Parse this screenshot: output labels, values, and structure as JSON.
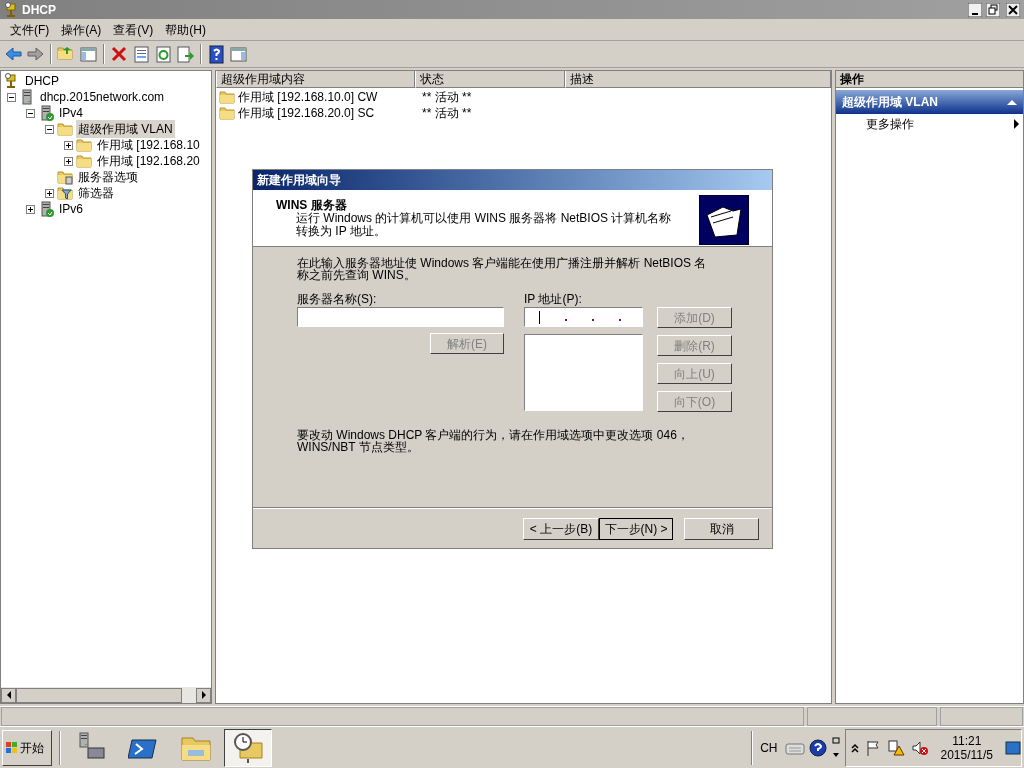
{
  "window": {
    "title": "DHCP"
  },
  "menu": [
    {
      "label": "文件(F)"
    },
    {
      "label": "操作(A)"
    },
    {
      "label": "查看(V)"
    },
    {
      "label": "帮助(H)"
    }
  ],
  "tree": [
    {
      "kind": "dhcp",
      "label": "DHCP",
      "selected": false,
      "children": [
        {
          "kind": "server",
          "label": "dhcp.2015network.com",
          "selected": false,
          "expanded": true,
          "children": [
            {
              "kind": "ipv4",
              "label": "IPv4",
              "selected": false,
              "expanded": true,
              "children": [
                {
                  "kind": "folder",
                  "label": "超级作用域 VLAN",
                  "selected": true,
                  "expanded": true,
                  "children": [
                    {
                      "kind": "folder",
                      "label": "作用域 [192.168.10",
                      "selected": false,
                      "expanded": false
                    },
                    {
                      "kind": "folder",
                      "label": "作用域 [192.168.20",
                      "selected": false,
                      "expanded": false
                    }
                  ]
                },
                {
                  "kind": "options",
                  "label": "服务器选项",
                  "selected": false
                },
                {
                  "kind": "filter",
                  "label": "筛选器",
                  "selected": false,
                  "expanded": false
                }
              ]
            },
            {
              "kind": "ipv4",
              "label": "IPv6",
              "selected": false,
              "expanded": false
            }
          ]
        }
      ]
    }
  ],
  "table": {
    "columns": [
      "超级作用域内容",
      "状态",
      "描述"
    ],
    "rows": [
      {
        "name": "作用域 [192.168.10.0] CW",
        "status": "** 活动 **"
      },
      {
        "name": "作用域 [192.168.20.0] SC",
        "status": "** 活动 **"
      }
    ]
  },
  "actions": {
    "title": "操作",
    "section": "超级作用域 VLAN",
    "expanded": true,
    "items": [
      "更多操作"
    ]
  },
  "dialog": {
    "title": "新建作用域向导",
    "header_title": "WINS 服务器",
    "header_text": "运行 Windows 的计算机可以使用 WINS 服务器将 NetBIOS 计算机名称转换为 IP 地址。",
    "intro": "在此输入服务器地址使 Windows 客户端能在使用广播注册并解析 NetBIOS 名称之前先查询 WINS。",
    "server_label": "服务器名称(S):",
    "ip_label": "IP 地址(P):",
    "resolve": {
      "label": "解析(E)",
      "disabled": true
    },
    "list_buttons": [
      {
        "label": "添加(D)",
        "disabled": true
      },
      {
        "label": "删除(R)",
        "disabled": true
      },
      {
        "label": "向上(U)",
        "disabled": true
      },
      {
        "label": "向下(O)",
        "disabled": true
      }
    ],
    "note": "要改动 Windows DHCP 客户端的行为，请在作用域选项中更改选项 046，WINS/NBT 节点类型。",
    "nav": [
      {
        "label": "< 上一步(B)",
        "default": false
      },
      {
        "label": "下一步(N) >",
        "default": true
      },
      {
        "label": "取消",
        "default": false
      }
    ]
  },
  "taskbar": {
    "start": "开始",
    "apps": [
      {
        "kind": "server",
        "selected": false
      },
      {
        "kind": "shell",
        "selected": false
      },
      {
        "kind": "explorer",
        "selected": false
      },
      {
        "kind": "dhcp",
        "selected": true
      }
    ],
    "language": "CH",
    "time": "11:21",
    "date": "2015/11/5"
  }
}
